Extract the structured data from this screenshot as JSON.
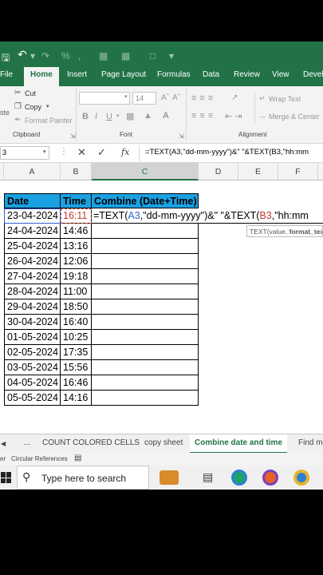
{
  "quick_access": {
    "save_icon": "save-icon",
    "undo_icon": "undo-icon",
    "redo_icon": "redo-icon"
  },
  "ribbon_tabs": [
    "File",
    "Home",
    "Insert",
    "Page Layout",
    "Formulas",
    "Data",
    "Review",
    "View",
    "Develo"
  ],
  "ribbon": {
    "cut": "Cut",
    "copy": "Copy",
    "format_painter": "Format Painter",
    "clipboard_group": "Clipboard",
    "paste_partial": "ste",
    "font_size": "14",
    "bold": "B",
    "italic": "I",
    "underline": "U",
    "font_group": "Font",
    "wrap_text": "Wrap Text",
    "merge_center": "Merge & Center",
    "alignment_group": "Alignment"
  },
  "formula_bar": {
    "name_box": "3",
    "fx": "fx",
    "formula": "=TEXT(A3,\"dd-mm-yyyy\")&\" \"&TEXT(B3,\"hh:mm"
  },
  "columns": [
    "A",
    "B",
    "C",
    "D",
    "E",
    "F"
  ],
  "table": {
    "headers": [
      "Date",
      "Time",
      "Combine (Date+Time)"
    ],
    "rows": [
      [
        "23-04-2024",
        "16:11"
      ],
      [
        "24-04-2024",
        "14:46"
      ],
      [
        "25-04-2024",
        "13:16"
      ],
      [
        "26-04-2024",
        "12:06"
      ],
      [
        "27-04-2024",
        "19:18"
      ],
      [
        "28-04-2024",
        "11:00"
      ],
      [
        "29-04-2024",
        "18:50"
      ],
      [
        "30-04-2024",
        "16:40"
      ],
      [
        "01-05-2024",
        "10:25"
      ],
      [
        "02-05-2024",
        "17:35"
      ],
      [
        "03-05-2024",
        "15:56"
      ],
      [
        "04-05-2024",
        "16:46"
      ],
      [
        "05-05-2024",
        "14:16"
      ]
    ]
  },
  "editing_cell": {
    "p1": "=TEXT(",
    "ref_a": "A3",
    "p2": ",\"dd-mm-yyyy\")&\" \"&TEXT(",
    "ref_b": "B3",
    "p3": ",\"hh:mm"
  },
  "tooltip": {
    "prefix": "TEXT(value, ",
    "bold": "format_tex"
  },
  "sheet_tabs": [
    "...",
    "COUNT COLORED CELLS",
    "copy sheet",
    "Combine date and time",
    "Find m"
  ],
  "status": {
    "left": "er",
    "circular": "Circular References"
  },
  "taskbar": {
    "search_placeholder": "Type here to search"
  },
  "colors": {
    "excel_green": "#217346",
    "header_fill": "#1ba1e2",
    "ref_a": "#2f5fd0",
    "ref_b": "#c0392b"
  }
}
